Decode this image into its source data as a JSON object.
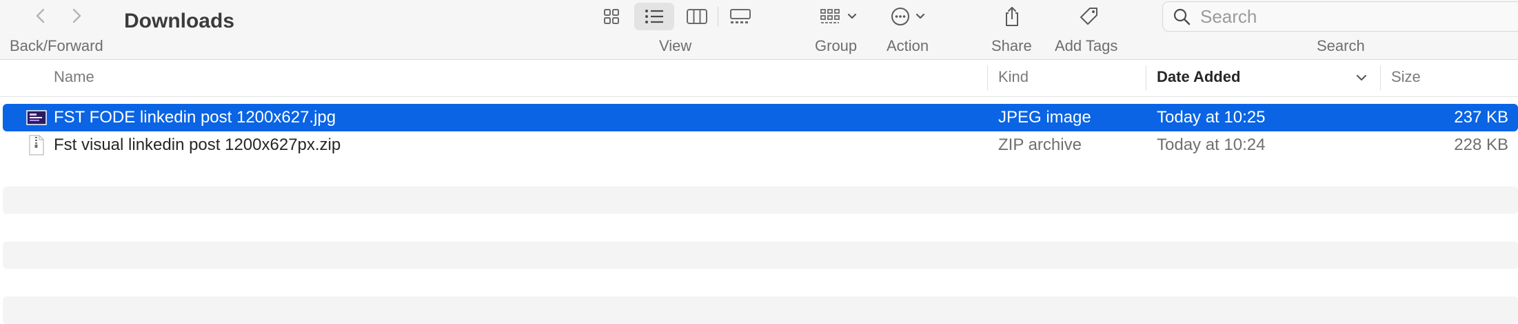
{
  "window": {
    "title": "Downloads"
  },
  "toolbar": {
    "back_forward_label": "Back/Forward",
    "view_label": "View",
    "group_label": "Group",
    "action_label": "Action",
    "share_label": "Share",
    "add_tags_label": "Add Tags",
    "search_label": "Search",
    "search_placeholder": "Search",
    "view_modes": [
      "icons-view-icon",
      "list-view-icon",
      "columns-view-icon",
      "gallery-view-icon"
    ],
    "active_view": "list"
  },
  "columns": {
    "name": "Name",
    "kind": "Kind",
    "date_added": "Date Added",
    "size": "Size",
    "sorted_by": "Date Added"
  },
  "files": [
    {
      "name": "FST FODE linkedin post 1200x627.jpg",
      "kind": "JPEG image",
      "date_added": "Today at 10:25",
      "size": "237 KB",
      "icon": "jpeg-thumbnail-icon",
      "selected": true
    },
    {
      "name": "Fst visual linkedin post 1200x627px.zip",
      "kind": "ZIP archive",
      "date_added": "Today at 10:24",
      "size": "228 KB",
      "icon": "zip-file-icon",
      "selected": false
    }
  ],
  "colors": {
    "selection": "#0a64e4",
    "toolbar_bg": "#f6f6f6",
    "stripe": "#f4f4f4"
  }
}
